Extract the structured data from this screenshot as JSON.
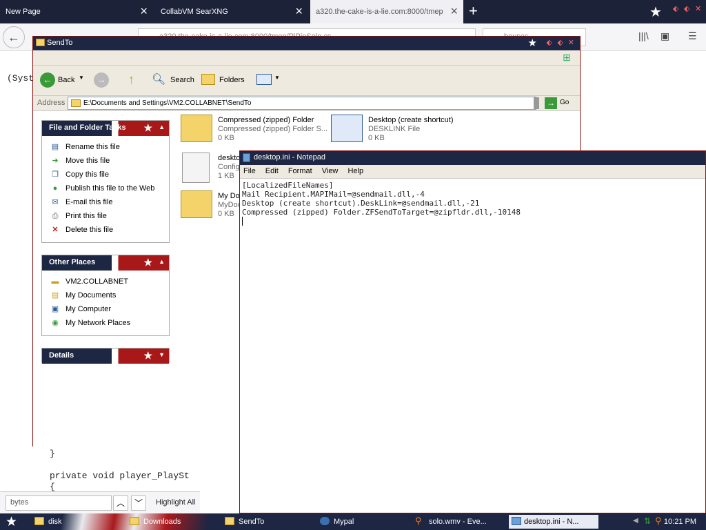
{
  "browser": {
    "tabs": [
      {
        "title": "New Page"
      },
      {
        "title": "CollabVM SearXNG"
      },
      {
        "title": "a320.the-cake-is-a-lie.com:8000/tmep"
      }
    ],
    "url": "a320.the-cake-is-a-lie.com:8000/tmep/PiPinSolo.cs",
    "search": "bouses",
    "code_line1": "(Syst",
    "code_lines": "}\n\nprivate void player_PlaySt\n{",
    "find_value": "bytes",
    "highlight_all": "Highlight All"
  },
  "explorer": {
    "title": "SendTo",
    "toolbar": {
      "back": "Back",
      "search": "Search",
      "folders": "Folders"
    },
    "address_label": "Address",
    "address_path": "E:\\Documents and Settings\\VM2.COLLABNET\\SendTo",
    "go": "Go",
    "panes": {
      "file_tasks": {
        "title": "File and Folder Tasks",
        "items": [
          "Rename this file",
          "Move this file",
          "Copy this file",
          "Publish this file to the Web",
          "E-mail this file",
          "Print this file",
          "Delete this file"
        ]
      },
      "other_places": {
        "title": "Other Places",
        "items": [
          "VM2.COLLABNET",
          "My Documents",
          "My Computer",
          "My Network Places"
        ]
      },
      "details": {
        "title": "Details"
      }
    },
    "files": [
      {
        "name": "Compressed (zipped) Folder",
        "type": "Compressed (zipped) Folder S...",
        "size": "0 KB"
      },
      {
        "name": "Desktop (create shortcut)",
        "type": "DESKLINK File",
        "size": "0 KB"
      },
      {
        "name": "deskto",
        "type": "Config",
        "size": "1 KB"
      },
      {
        "name": "My Doc",
        "type": "MyDoc",
        "size": "0 KB"
      }
    ]
  },
  "notepad": {
    "title": "desktop.ini - Notepad",
    "menu": [
      "File",
      "Edit",
      "Format",
      "View",
      "Help"
    ],
    "content": "[LocalizedFileNames]\nMail Recipient.MAPIMail=@sendmail.dll,-4\nDesktop (create shortcut).DeskLink=@sendmail.dll,-21\nCompressed (zipped) Folder.ZFSendToTarget=@zipfldr.dll,-10148"
  },
  "taskbar": {
    "items": [
      {
        "label": "disk"
      },
      {
        "label": "Downloads"
      },
      {
        "label": "SendTo"
      },
      {
        "label": "Mypal"
      },
      {
        "label": "solo.wmv - Eve..."
      },
      {
        "label": "desktop.ini - N..."
      }
    ],
    "clock": "10:21 PM"
  }
}
